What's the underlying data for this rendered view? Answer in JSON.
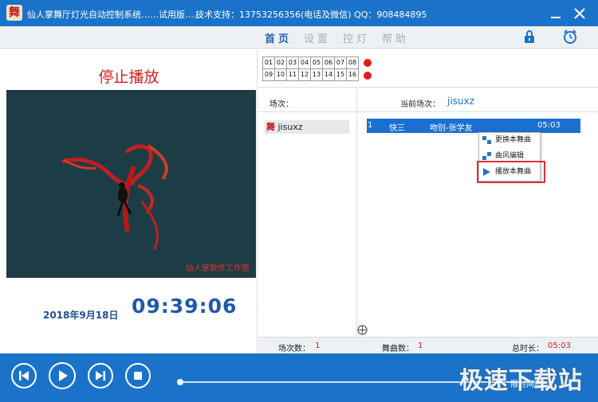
{
  "titlebar": {
    "logo_char": "舞",
    "title": "仙人掌舞厅灯光自动控制系统……试用版……",
    "support": "技术支持：13753256356(电话及微信)   QQ：908484895",
    "minimize_icon": "minimize-icon",
    "close_icon": "close-icon"
  },
  "menubar": {
    "items": [
      "首页",
      "设置",
      "控灯",
      "帮助"
    ],
    "active": "首页",
    "lock_icon": "lock-icon",
    "clock_icon": "alarm-clock-icon"
  },
  "left": {
    "status": "停止播放",
    "video_caption": "仙人掌软件工作室",
    "date": "2018年9月18日",
    "time": "09:39:06",
    "collapse": "《"
  },
  "grid": {
    "row1": [
      "01",
      "02",
      "03",
      "04",
      "05",
      "06",
      "07",
      "08"
    ],
    "row2": [
      "09",
      "10",
      "11",
      "12",
      "13",
      "14",
      "15",
      "16"
    ],
    "dot_color": "#e01c1c"
  },
  "sessions": {
    "label": "场次：",
    "current_label": "当前场次：",
    "current_value": "jisuxz",
    "items": [
      {
        "icon_char": "舞",
        "name": "jisuxz"
      }
    ]
  },
  "songs": [
    {
      "index": "1",
      "type": "快三",
      "title": "吻别-张学友",
      "duration": "05:03"
    }
  ],
  "context_menu": {
    "items": [
      "更换本舞曲",
      "曲风编辑",
      "播放本舞曲"
    ],
    "highlighted": "播放本舞曲"
  },
  "footer": {
    "sessions_count_label": "场次数：",
    "sessions_count": "1",
    "songs_count_label": "舞曲数：",
    "songs_count": "1",
    "total_label": "总时长：",
    "total_value": "05:03"
  },
  "player": {
    "progress": 0,
    "cut_text": "限时间随…",
    "watermark": "极速下载站"
  },
  "colors": {
    "accent": "#1a73c9",
    "red": "#d3201d",
    "selection": "#1a6fd1"
  }
}
